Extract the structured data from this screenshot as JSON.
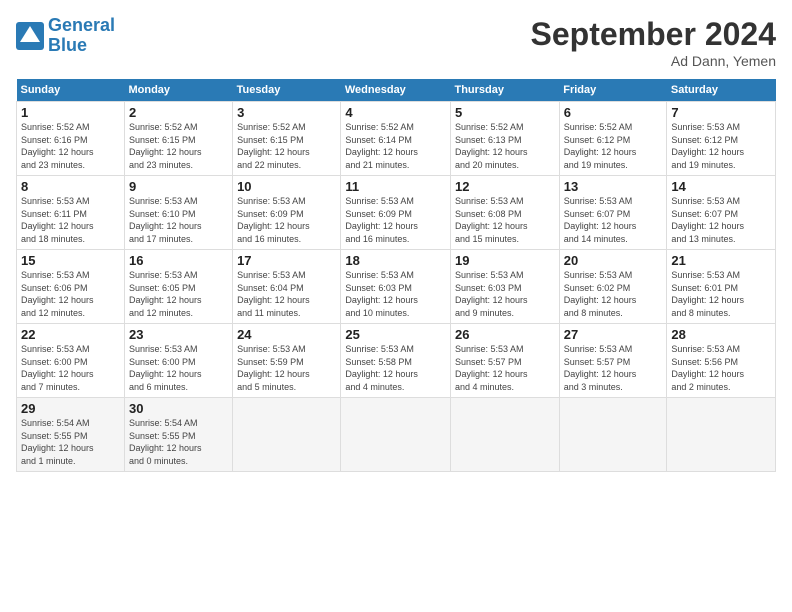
{
  "header": {
    "logo_line1": "General",
    "logo_line2": "Blue",
    "month_title": "September 2024",
    "location": "Ad Dann, Yemen"
  },
  "weekdays": [
    "Sunday",
    "Monday",
    "Tuesday",
    "Wednesday",
    "Thursday",
    "Friday",
    "Saturday"
  ],
  "weeks": [
    [
      {
        "day": "1",
        "sunrise": "5:52 AM",
        "sunset": "6:16 PM",
        "daylight": "12 hours and 23 minutes."
      },
      {
        "day": "2",
        "sunrise": "5:52 AM",
        "sunset": "6:15 PM",
        "daylight": "12 hours and 23 minutes."
      },
      {
        "day": "3",
        "sunrise": "5:52 AM",
        "sunset": "6:15 PM",
        "daylight": "12 hours and 22 minutes."
      },
      {
        "day": "4",
        "sunrise": "5:52 AM",
        "sunset": "6:14 PM",
        "daylight": "12 hours and 21 minutes."
      },
      {
        "day": "5",
        "sunrise": "5:52 AM",
        "sunset": "6:13 PM",
        "daylight": "12 hours and 20 minutes."
      },
      {
        "day": "6",
        "sunrise": "5:52 AM",
        "sunset": "6:12 PM",
        "daylight": "12 hours and 19 minutes."
      },
      {
        "day": "7",
        "sunrise": "5:53 AM",
        "sunset": "6:12 PM",
        "daylight": "12 hours and 19 minutes."
      }
    ],
    [
      {
        "day": "8",
        "sunrise": "5:53 AM",
        "sunset": "6:11 PM",
        "daylight": "12 hours and 18 minutes."
      },
      {
        "day": "9",
        "sunrise": "5:53 AM",
        "sunset": "6:10 PM",
        "daylight": "12 hours and 17 minutes."
      },
      {
        "day": "10",
        "sunrise": "5:53 AM",
        "sunset": "6:09 PM",
        "daylight": "12 hours and 16 minutes."
      },
      {
        "day": "11",
        "sunrise": "5:53 AM",
        "sunset": "6:09 PM",
        "daylight": "12 hours and 16 minutes."
      },
      {
        "day": "12",
        "sunrise": "5:53 AM",
        "sunset": "6:08 PM",
        "daylight": "12 hours and 15 minutes."
      },
      {
        "day": "13",
        "sunrise": "5:53 AM",
        "sunset": "6:07 PM",
        "daylight": "12 hours and 14 minutes."
      },
      {
        "day": "14",
        "sunrise": "5:53 AM",
        "sunset": "6:07 PM",
        "daylight": "12 hours and 13 minutes."
      }
    ],
    [
      {
        "day": "15",
        "sunrise": "5:53 AM",
        "sunset": "6:06 PM",
        "daylight": "12 hours and 12 minutes."
      },
      {
        "day": "16",
        "sunrise": "5:53 AM",
        "sunset": "6:05 PM",
        "daylight": "12 hours and 12 minutes."
      },
      {
        "day": "17",
        "sunrise": "5:53 AM",
        "sunset": "6:04 PM",
        "daylight": "12 hours and 11 minutes."
      },
      {
        "day": "18",
        "sunrise": "5:53 AM",
        "sunset": "6:03 PM",
        "daylight": "12 hours and 10 minutes."
      },
      {
        "day": "19",
        "sunrise": "5:53 AM",
        "sunset": "6:03 PM",
        "daylight": "12 hours and 9 minutes."
      },
      {
        "day": "20",
        "sunrise": "5:53 AM",
        "sunset": "6:02 PM",
        "daylight": "12 hours and 8 minutes."
      },
      {
        "day": "21",
        "sunrise": "5:53 AM",
        "sunset": "6:01 PM",
        "daylight": "12 hours and 8 minutes."
      }
    ],
    [
      {
        "day": "22",
        "sunrise": "5:53 AM",
        "sunset": "6:00 PM",
        "daylight": "12 hours and 7 minutes."
      },
      {
        "day": "23",
        "sunrise": "5:53 AM",
        "sunset": "6:00 PM",
        "daylight": "12 hours and 6 minutes."
      },
      {
        "day": "24",
        "sunrise": "5:53 AM",
        "sunset": "5:59 PM",
        "daylight": "12 hours and 5 minutes."
      },
      {
        "day": "25",
        "sunrise": "5:53 AM",
        "sunset": "5:58 PM",
        "daylight": "12 hours and 4 minutes."
      },
      {
        "day": "26",
        "sunrise": "5:53 AM",
        "sunset": "5:57 PM",
        "daylight": "12 hours and 4 minutes."
      },
      {
        "day": "27",
        "sunrise": "5:53 AM",
        "sunset": "5:57 PM",
        "daylight": "12 hours and 3 minutes."
      },
      {
        "day": "28",
        "sunrise": "5:53 AM",
        "sunset": "5:56 PM",
        "daylight": "12 hours and 2 minutes."
      }
    ],
    [
      {
        "day": "29",
        "sunrise": "5:54 AM",
        "sunset": "5:55 PM",
        "daylight": "12 hours and 1 minute."
      },
      {
        "day": "30",
        "sunrise": "5:54 AM",
        "sunset": "5:55 PM",
        "daylight": "12 hours and 0 minutes."
      },
      null,
      null,
      null,
      null,
      null
    ]
  ]
}
